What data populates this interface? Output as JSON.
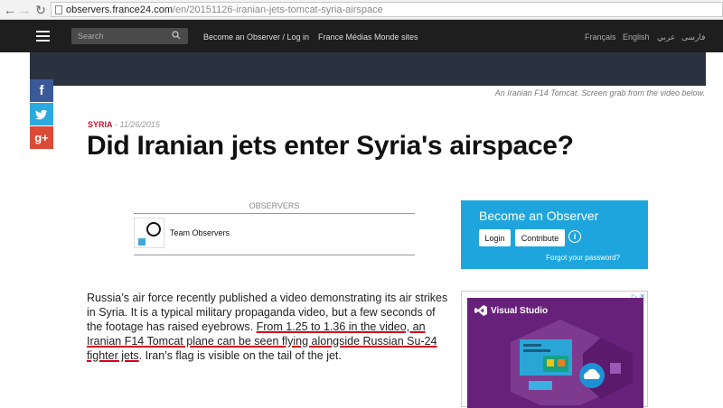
{
  "browser": {
    "url_host": "observers.france24.com",
    "url_path": "/en/20151126-iranian-jets-tomcat-syria-airspace",
    "icons": [
      "back-icon",
      "forward-icon",
      "reload-icon",
      "page-icon"
    ]
  },
  "nav": {
    "search_placeholder": "Search",
    "login_link": "Become an Observer / Log in",
    "fmm_link": "France Médias Monde sites",
    "languages": [
      "Français",
      "English",
      "عربي",
      "فارسی"
    ]
  },
  "hero": {
    "caption": "An Iranian F14 Tomcat. Screen grab from the video below."
  },
  "article": {
    "category": "SYRIA",
    "date": " - 11/26/2015",
    "headline": "Did Iranian jets enter Syria's airspace?",
    "observers_label": "OBSERVERS",
    "observer_name": "Team Observers",
    "body_before": "Russia’s air force recently published a video demonstrating its air strikes in Syria. It is a typical military propaganda video, but a few seconds of the footage has raised eyebrows. ",
    "body_highlight": "From 1.25 to 1.36 in the video, an Iranian F14 Tomcat plane can be seen flying alongside Russian Su-24 fighter jets",
    "body_after": ". Iran’s flag is visible on the tail of the jet."
  },
  "observer_panel": {
    "title": "Become an Observer",
    "login_label": "Login",
    "contribute_label": "Contribute",
    "info_glyph": "i",
    "forgot_link": "Forgot your password?"
  },
  "ad": {
    "brand": "Visual Studio",
    "close_label": "▷ ✕"
  },
  "colors": {
    "nav_bg": "#1e1e1e",
    "accent_red": "#c8102e",
    "observer_blue": "#1ea5dd",
    "ad_purple": "#68217a"
  }
}
